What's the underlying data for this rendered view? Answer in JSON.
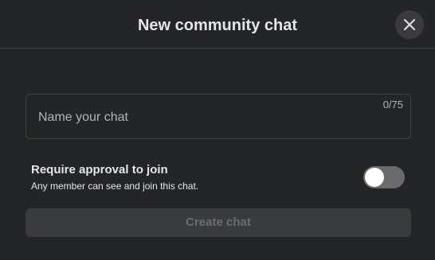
{
  "dialog": {
    "title": "New community chat",
    "close_icon": "close-icon"
  },
  "name_field": {
    "placeholder": "Name your chat",
    "value": "",
    "char_count": "0/75"
  },
  "approval": {
    "title": "Require approval to join",
    "description": "Any member can see and join this chat.",
    "toggle_on": false
  },
  "create_button": {
    "label": "Create chat",
    "enabled": false
  },
  "colors": {
    "background": "#242526",
    "text_primary": "#e4e6eb",
    "text_secondary": "#b0b3b8",
    "button_disabled_bg": "#3a3b3c",
    "button_disabled_text": "#6b6d70",
    "toggle_off": "#6a6b6d"
  }
}
